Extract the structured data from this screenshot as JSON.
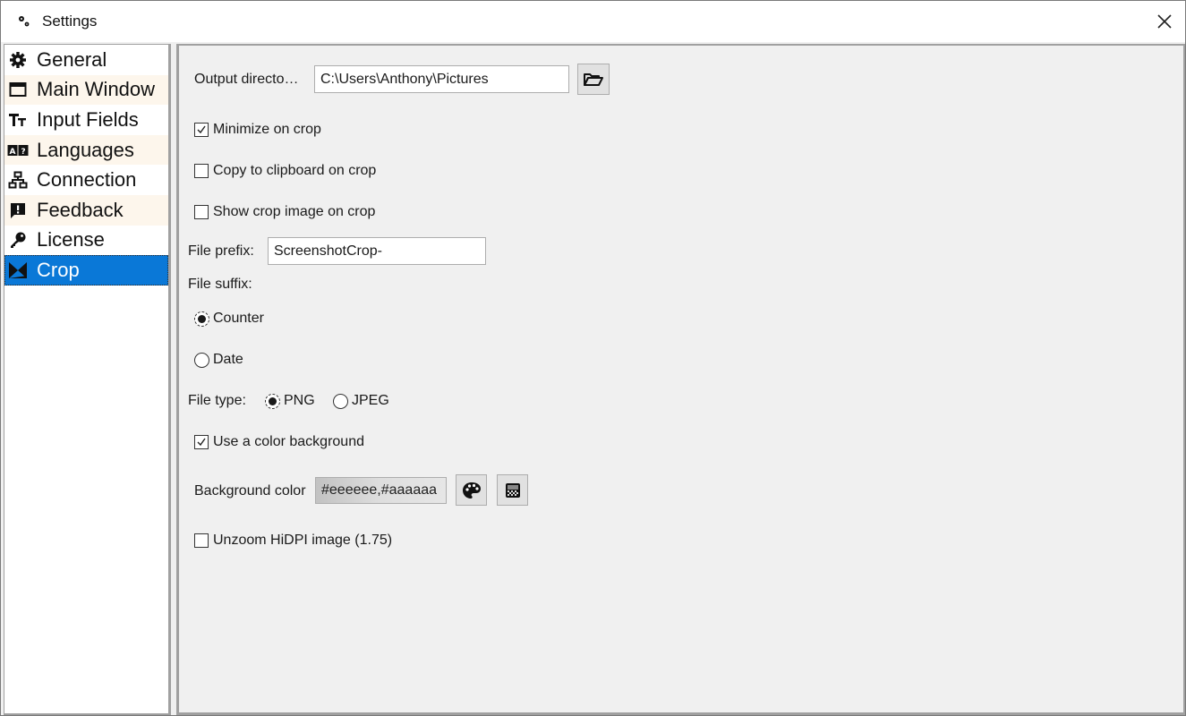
{
  "window": {
    "title": "Settings",
    "icon": "settings-gears-icon",
    "close_icon": "close-icon"
  },
  "sidebar": {
    "selected": "Crop",
    "items": [
      {
        "label": "General",
        "icon": "gear-icon"
      },
      {
        "label": "Main Window",
        "icon": "window-icon"
      },
      {
        "label": "Input Fields",
        "icon": "text-size-icon"
      },
      {
        "label": "Languages",
        "icon": "translate-icon"
      },
      {
        "label": "Connection",
        "icon": "network-icon"
      },
      {
        "label": "Feedback",
        "icon": "feedback-icon"
      },
      {
        "label": "License",
        "icon": "key-icon"
      },
      {
        "label": "Crop",
        "icon": "crop-icon"
      }
    ]
  },
  "crop": {
    "output_directory": {
      "label": "Output directo…",
      "value": "C:\\Users\\Anthony\\Pictures",
      "browse_icon": "folder-open-icon"
    },
    "minimize_on_crop": {
      "label": "Minimize on crop",
      "checked": true
    },
    "copy_to_clipboard": {
      "label": "Copy to clipboard on crop",
      "checked": false
    },
    "show_crop_image": {
      "label": "Show crop image on crop",
      "checked": false
    },
    "file_prefix": {
      "label": "File prefix:",
      "value": "ScreenshotCrop-"
    },
    "file_suffix": {
      "label": "File suffix:",
      "options": [
        {
          "label": "Counter",
          "selected": true
        },
        {
          "label": "Date",
          "selected": false
        }
      ]
    },
    "file_type": {
      "label": "File type:",
      "options": [
        {
          "label": "PNG",
          "selected": true
        },
        {
          "label": "JPEG",
          "selected": false
        }
      ]
    },
    "use_color_background": {
      "label": "Use a color background",
      "checked": true
    },
    "background_color": {
      "label": "Background color",
      "value": "#eeeeee,#aaaaaa",
      "palette_icon": "palette-icon",
      "pattern_icon": "pattern-icon"
    },
    "unzoom_hidpi": {
      "label": "Unzoom HiDPI image (1.75)",
      "checked": false
    }
  },
  "colors": {
    "selection": "#0a78d7",
    "alt_row": "#fdf6ec",
    "panel_bg": "#f0f0f0"
  }
}
